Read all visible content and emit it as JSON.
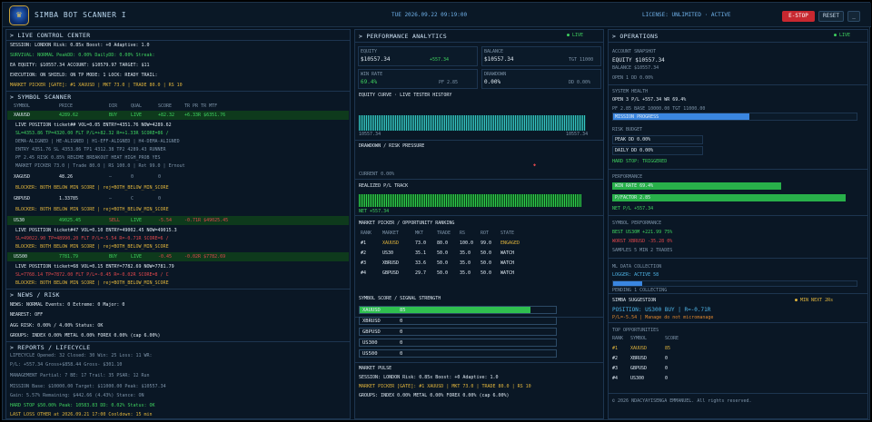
{
  "header": {
    "title": "SIMBA BOT SCANNER I",
    "clock": "TUE  2026.09.22  09:19:00",
    "license": "LICENSE: UNLIMITED · ACTIVE",
    "estop": "E-STOP",
    "reset": "RESET",
    "minimize": "_"
  },
  "left": {
    "live_control_title": "> LIVE CONTROL CENTER",
    "session_line": "SESSION: LONDON        Risk: 0.85x    Boost: +0    Adaptive: 1.0",
    "survival_line": "SURVIVAL: NORMAL      PeakDD: 0.00%    DailyDD: 0.00%    Streak:",
    "equity_line": "EA EQUITY: $10557.34      ACCOUNT: $10579.97      TARGET: $11",
    "exec_line": "EXECUTION: ON    SHIELD: ON    TP MODE: 1    LOCK: READY    TRAIL:",
    "market_picker": "MARKET PICKER [GATE]: #1 XAUUSD | MKT 73.0 | TRADE 80.0 | RS 10",
    "symbol_scanner_title": "> SYMBOL SCANNER",
    "scanner_headers": [
      "SYMBOL",
      "PRICE",
      "DIR",
      "QUAL",
      "SCORE",
      "TR PR TR MTF"
    ],
    "row1": {
      "sym": "XAUUSD",
      "price": "4289.62",
      "dir": "BUY",
      "qual": "LIVE",
      "score": "+82.32",
      "extra": "+6.33R $6351.76"
    },
    "row1_details": [
      "LIVE POSITION  ticket##  VOL=0.05  ENTRY=4351.76  NOW=4289.62",
      "SL=4353.86  TP=4320.00  FLT P/L=+82.32  R=+1.33R  SCORE=86 /",
      "DEMA-ALIGNED | HE-ALIGNED | H1-EFF-ALIGNED | H4-DEMA-ALIGNED",
      "ENTRY 4351.76   SL 4353.86   TP1 4312.38   TP2 4289.43   RUNNER",
      "PF 2.45   RISK 0.85%   REGIME BREAKOUT   HEAT   HIGH_PROB  YES",
      "MARKET PICKER 73.0 | Trade 80.0 | RS 100.0 | Rot 99.0 | Ernout"
    ],
    "row2": {
      "sym": "XAGUSD",
      "price": "48.26",
      "dir": "—",
      "qual": "0",
      "score": "0"
    },
    "row2_block": "BLOCKER: BOTH BELOW MIN SCORE | rej=BOTH_BELOW_MIN_SCORE",
    "row3": {
      "sym": "GBPUSD",
      "price": "1.33785",
      "dir": "—",
      "qual": "C",
      "score": "0"
    },
    "row3_block": "BLOCKER: BOTH BELOW MIN SCORE | rej=BOTH_BELOW_MIN_SCORE",
    "row4": {
      "sym": "US30",
      "price": "49025.45",
      "dir": "SELL",
      "qual": "LIVE",
      "score": "-5.54",
      "extra": "-0.71R  $49025.45"
    },
    "row4_details": [
      "LIVE POSITION  ticket#47  VOL=0.10  ENTRY=49002.45  NOW=49015.3",
      "SL=49022.90  TP=48990.20  FLT P/L=-5.54  R=-0.71R  SCORE=6 /",
      "BLOCKER: BOTH BELOW MIN SCORE | rej=BOTH_BELOW_MIN_SCORE"
    ],
    "row5": {
      "sym": "US500",
      "price": "7781.79",
      "dir": "BUY",
      "qual": "LIVE",
      "score": "-0.45",
      "extra": "-0.02R  $7782.69"
    },
    "row5_details": [
      "LIVE POSITION  ticket=68  VOL=0.15  ENTRY=7782.69  NOW=7781.79",
      "SL=7768.14  TP=7872.00  FLT P/L=-0.45  R=-0.02R  SCORE=8 / C",
      "BLOCKER: BOTH BELOW MIN SCORE | rej=BOTH_BELOW_MIN_SCORE"
    ],
    "news_title": "> NEWS / RISK",
    "news_line": "NEWS: NORMAL        Events: 0    Extreme: 0    Major: 0",
    "nearest": "NEAREST: OFF",
    "agg_risk": "AGG RISK: 0.00% / 4.00%     Status: OK",
    "groups": "GROUPS: INDEX 0.00%    METAL 0.00%    FOREX 0.00%    (cap 6.00%)",
    "reports_title": "> REPORTS / LIFECYCLE",
    "reports": [
      "LIFECYCLE    Opened: 32    Closed: 30    Win: 25    Loss: 11    WR:",
      "             P/L: +557.34    Gross+$858.44    Gross- $301.10",
      "MANAGEMENT   Partial: 7    BE: 17    Trail: 35    PSAR: 12    Run",
      "MISSION   Base: $10000.00    Target: $11000.00    Peak: $10557.34",
      "          Gain: 5.57%    Remaining: $442.66 (4.43%)    Stance: ON"
    ],
    "hard_stop": "HARD STOP  $50.00%    Peak: 10583.83    DD: 0.02%    Status: OK",
    "last_loss": "LAST LOSS    OTHER at 2026.09.21 17:00    Cooldown: 15 min"
  },
  "mid": {
    "title": "> PERFORMANCE ANALYTICS",
    "live": "● LIVE",
    "equity_label": "EQUITY",
    "equity_value": "$10557.34",
    "equity_sub": "+557.34",
    "balance_label": "BALANCE",
    "balance_value": "$10557.34",
    "balance_sub": "TGT 11000",
    "winrate_label": "WIN RATE",
    "winrate_value": "69.4%",
    "winrate_sub": "PF 2.85",
    "drawdown_label": "DRAWDOWN",
    "drawdown_value": "0.00%",
    "drawdown_sub": "DD 0.00%",
    "equity_curve_title": "EQUITY CURVE  ·  LIVE TESTER HISTORY",
    "curve_left": "10557.34",
    "curve_right": "10557.34",
    "drawdown_title": "DRAWDOWN / RISK PRESSURE",
    "current_dd": "CURRENT 0.00%",
    "realized_title": "REALIZED P/L TRACK",
    "net": "NET +557.34",
    "ranking_title": "MARKET PICKER / OPPORTUNITY RANKING",
    "ranking_headers": [
      "RANK",
      "MARKET",
      "MKT",
      "TRADE",
      "RS",
      "ROT",
      "STATE"
    ],
    "ranking_rows": [
      [
        "#1",
        "XAUUSD",
        "73.0",
        "80.0",
        "100.0",
        "99.0",
        "ENGAGED"
      ],
      [
        "#2",
        "US30",
        "35.1",
        "50.0",
        "35.0",
        "50.0",
        "WATCH"
      ],
      [
        "#3",
        "XBRUSD",
        "33.6",
        "50.0",
        "35.0",
        "50.0",
        "WATCH"
      ],
      [
        "#4",
        "GBPUSD",
        "29.7",
        "50.0",
        "35.0",
        "50.0",
        "WATCH"
      ]
    ],
    "signal_title": "SYMBOL SCORE / SIGNAL STRENGTH",
    "signals": [
      {
        "sym": "XAUUSD",
        "score": "85",
        "pct": 0.87
      },
      {
        "sym": "XBRUSD",
        "score": "0",
        "pct": 0
      },
      {
        "sym": "GBPUSD",
        "score": "0",
        "pct": 0
      },
      {
        "sym": "US300",
        "score": "0",
        "pct": 0
      },
      {
        "sym": "US500",
        "score": "0",
        "pct": 0
      }
    ],
    "pulse_title": "MARKET PULSE",
    "pulse_line1": "SESSION: LONDON        Risk: 0.85x    Boost: +0    Adaptive: 1.0",
    "pulse_line2": "MARKET PICKER [GATE]: #1 XAUUSD | MKT 73.0 | TRADE 80.0 | RS 10",
    "pulse_line3": "GROUPS: INDEX 0.00%    METAL 0.00%    FOREX 0.00%    (cap 6.00%)"
  },
  "right": {
    "title": "> OPERATIONS",
    "live": "● LIVE",
    "snapshot_title": "ACCOUNT SNAPSHOT",
    "snap_equity": "EQUITY   $10557.34",
    "snap_balance": "BALANCE    $10557.34",
    "snap_open": "OPEN 1    DD 0.00%",
    "health_title": "SYSTEM HEALTH",
    "health_line1": "OPEN 3  P/L +557.34  WR 69.4%",
    "health_line2": "PF 2.85   BASE 10000.00   TGT 11000.00",
    "mission_label": "MISSION PROGRESS",
    "mission_pct": 0.56,
    "budget_title": "RISK BUDGET",
    "peak_dd": "PEAK DD     0.00%",
    "daily_dd": "DAILY DD     0.00%",
    "hard_stop": "HARD STOP: TRIGGERED",
    "perf_title": "PERFORMANCE",
    "win_rate": "WIN RATE  69.4%",
    "win_pct": 0.69,
    "pfactor": "P/FACTOR  2.85",
    "pf_pct": 0.95,
    "net_pl": "NET P/L  +557.34",
    "symperf_title": "SYMBOL PERFORMANCE",
    "best": "BEST  US30M    +221.99   75%",
    "worst": "WORST XBRUSD    -35.28   0%",
    "samples": "SAMPLES 5    MIN 2 TRADES",
    "ml_title": "ML DATA COLLECTION",
    "logger": "LOGGER: ACTIVE     58",
    "ml_pct": 0.12,
    "ml_sub": "PENDING 1    COLLECTING",
    "suggest_title": "SIMBA SUGGESTION",
    "suggest_badge": "● MIN  NEXT 2Rs",
    "suggest_line1": "POSITION: US300 BUY | R=-0.71R",
    "suggest_line2": "P/L=-5.54 | Manage   do not micromanage",
    "top_title": "TOP OPPORTUNITIES",
    "top_headers": [
      "RANK",
      "SYMBOL",
      "SCORE"
    ],
    "top_rows": [
      [
        "#1",
        "XAUUSD",
        "85"
      ],
      [
        "#2",
        "XBRUSD",
        "0"
      ],
      [
        "#3",
        "GBPUSD",
        "0"
      ],
      [
        "#4",
        "US300",
        "0"
      ]
    ],
    "footer": "© 2026 NDACYAYISENGA EMMANUEL. All rights reserved."
  }
}
